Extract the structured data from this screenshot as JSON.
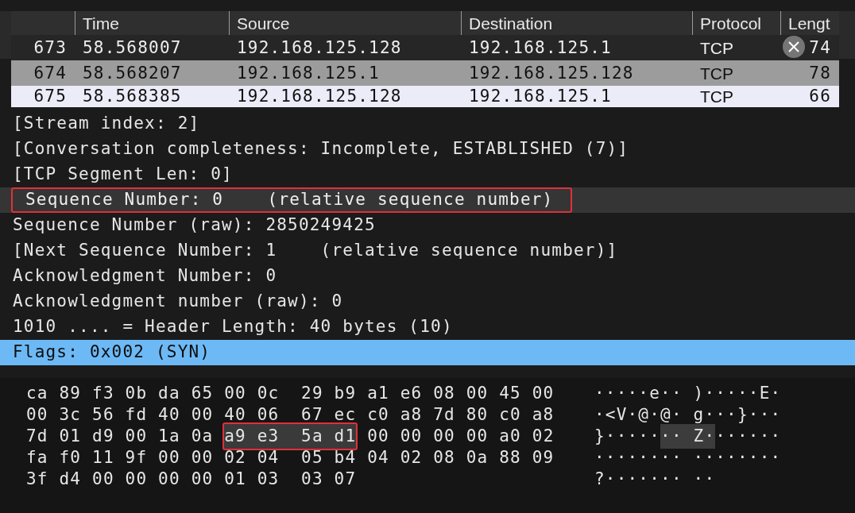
{
  "packet_list": {
    "columns": [
      {
        "label": "Time"
      },
      {
        "label": "Source"
      },
      {
        "label": "Destination"
      },
      {
        "label": "Protocol"
      },
      {
        "label": "Lengt"
      }
    ],
    "rows": [
      {
        "no": "673",
        "time": "58.568007",
        "source": "192.168.125.128",
        "destination": "192.168.125.1",
        "protocol": "TCP",
        "length": "74",
        "kind": "plain",
        "selected": false
      },
      {
        "no": "674",
        "time": "58.568207",
        "source": "192.168.125.1",
        "destination": "192.168.125.128",
        "protocol": "TCP",
        "length": "78",
        "kind": "shaded",
        "selected": false
      },
      {
        "no": "675",
        "time": "58.568385",
        "source": "192.168.125.128",
        "destination": "192.168.125.1",
        "protocol": "TCP",
        "length": "66",
        "selected": true
      }
    ]
  },
  "details": [
    {
      "text": "[Stream index: 2]",
      "selected": false,
      "outlined": false
    },
    {
      "text": "[Conversation completeness: Incomplete, ESTABLISHED (7)]",
      "selected": false,
      "outlined": false
    },
    {
      "text": "[TCP Segment Len: 0]",
      "selected": false,
      "outlined": false
    },
    {
      "text": "Sequence Number: 0    (relative sequence number)",
      "selected": false,
      "outlined": true
    },
    {
      "text": "Sequence Number (raw): 2850249425",
      "selected": false,
      "outlined": false
    },
    {
      "text": "[Next Sequence Number: 1    (relative sequence number)]",
      "selected": false,
      "outlined": false
    },
    {
      "text": "Acknowledgment Number: 0",
      "selected": false,
      "outlined": false
    },
    {
      "text": "Acknowledgment number (raw): 0",
      "selected": false,
      "outlined": false
    },
    {
      "text": "1010 .... = Header Length: 40 bytes (10)",
      "selected": false,
      "outlined": false
    },
    {
      "text": "Flags: 0x002 (SYN)",
      "selected": true,
      "outlined": false
    }
  ],
  "bytes": [
    {
      "hex": [
        {
          "text": "ca 89 f3 0b da 65 00 0c  29 b9 a1 e6 08 00 45 00",
          "highlighted": false
        }
      ],
      "ascii": [
        {
          "text": "·····e·· )·····E·",
          "highlighted": false
        }
      ]
    },
    {
      "hex": [
        {
          "text": "00 3c 56 fd 40 00 40 06  67 ec c0 a8 7d 80 c0 a8",
          "highlighted": false
        }
      ],
      "ascii": [
        {
          "text": "·<V·@·@· g···}···",
          "highlighted": false
        }
      ]
    },
    {
      "hex": [
        {
          "text": "7d 01 d9 00 1a 0a ",
          "highlighted": false
        },
        {
          "text": "a9 e3  5a d1",
          "highlighted": true
        },
        {
          "text": " 00 00 00 00 a0 02",
          "highlighted": false
        }
      ],
      "ascii": [
        {
          "text": "}·····",
          "highlighted": false
        },
        {
          "text": "·· Z·",
          "highlighted": true
        },
        {
          "text": "······",
          "highlighted": false
        }
      ]
    },
    {
      "hex": [
        {
          "text": "fa f0 11 9f 00 00 02 04  05 b4 04 02 08 0a 88 09",
          "highlighted": false
        }
      ],
      "ascii": [
        {
          "text": "········ ········",
          "highlighted": false
        }
      ]
    },
    {
      "hex": [
        {
          "text": "3f d4 00 00 00 00 01 03  03 07",
          "highlighted": false
        }
      ],
      "ascii": [
        {
          "text": "?······· ··",
          "highlighted": false
        }
      ]
    }
  ]
}
